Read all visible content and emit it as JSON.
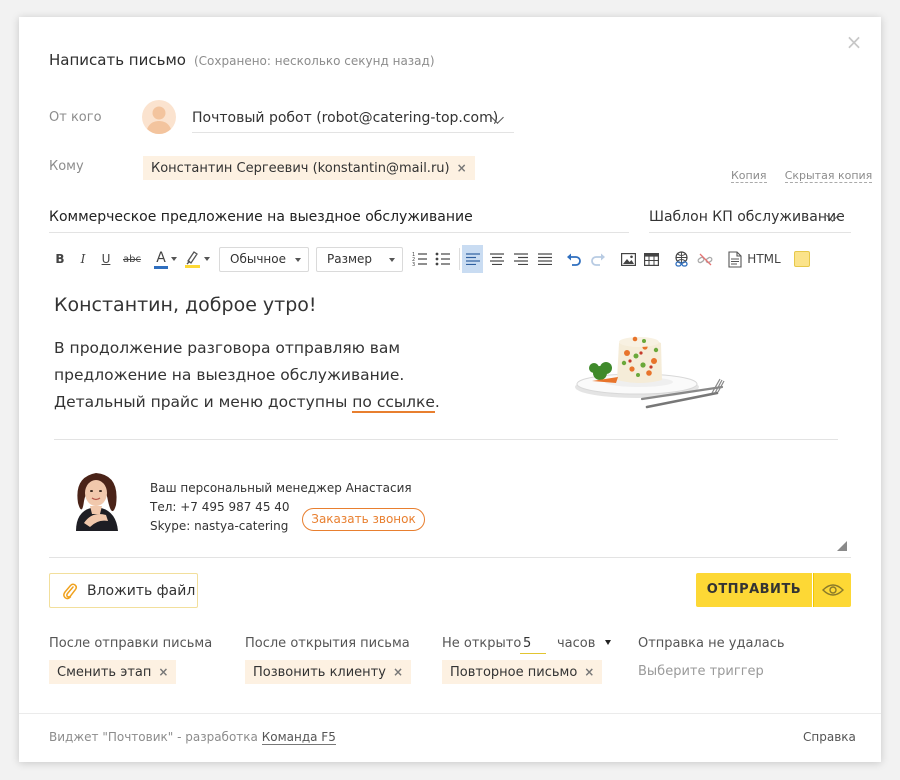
{
  "dialog": {
    "title": "Написать письмо",
    "saved_status": "(Сохранено: несколько секунд назад)",
    "close_symbol": "×"
  },
  "from": {
    "label": "От кого",
    "value": "Почтовый робот (robot@catering-top.com)"
  },
  "to": {
    "label": "Кому",
    "recipient": "Константин Сергеевич (konstantin@mail.ru)",
    "remove_symbol": "×",
    "cc_label": "Копия",
    "bcc_label": "Скрытая копия"
  },
  "subject": {
    "value": "Коммерческое предложение на выездное обслуживание"
  },
  "template": {
    "value": "Шаблон КП обслуживание"
  },
  "toolbar": {
    "bold": "B",
    "italic": "I",
    "underline": "U",
    "strike": "abc",
    "font_color_letter": "A",
    "format_select": "Обычное",
    "size_select": "Размер",
    "html_label": "HTML",
    "accent_color": "#e87f2f",
    "highlight_color": "#fdd835",
    "active_color": "#c9dcf2"
  },
  "message": {
    "greeting": "Константин, доброе утро!",
    "line1": "В продолжение разговора отправляю вам",
    "line2": "предложение на выездное обслуживание.",
    "line3_prefix": "Детальный прайс и меню доступны ",
    "line3_link": "по ссылке",
    "line3_suffix": "."
  },
  "signature": {
    "line1": "Ваш персональный менеджер Анастасия",
    "line2": "Тел: +7 495 987 45 40",
    "line3": "Skype: nastya-catering",
    "call_button": "Заказать звонок"
  },
  "actions": {
    "attach": "Вложить файл",
    "send": "ОТПРАВИТЬ"
  },
  "triggers": [
    {
      "header": "После отправки письма",
      "value": "Сменить этап",
      "remove_symbol": "×"
    },
    {
      "header": "После открытия письма",
      "value": "Позвонить клиенту",
      "remove_symbol": "×"
    },
    {
      "header_prefix": "Не открыто",
      "hours": "5",
      "hours_unit": "часов",
      "value": "Повторное письмо",
      "remove_symbol": "×"
    },
    {
      "header": "Отправка не удалась",
      "placeholder": "Выберите триггер"
    }
  ],
  "footer": {
    "prefix": "Виджет \"Почтовик\" - разработка",
    "team": "Команда F5",
    "help": "Справка"
  }
}
